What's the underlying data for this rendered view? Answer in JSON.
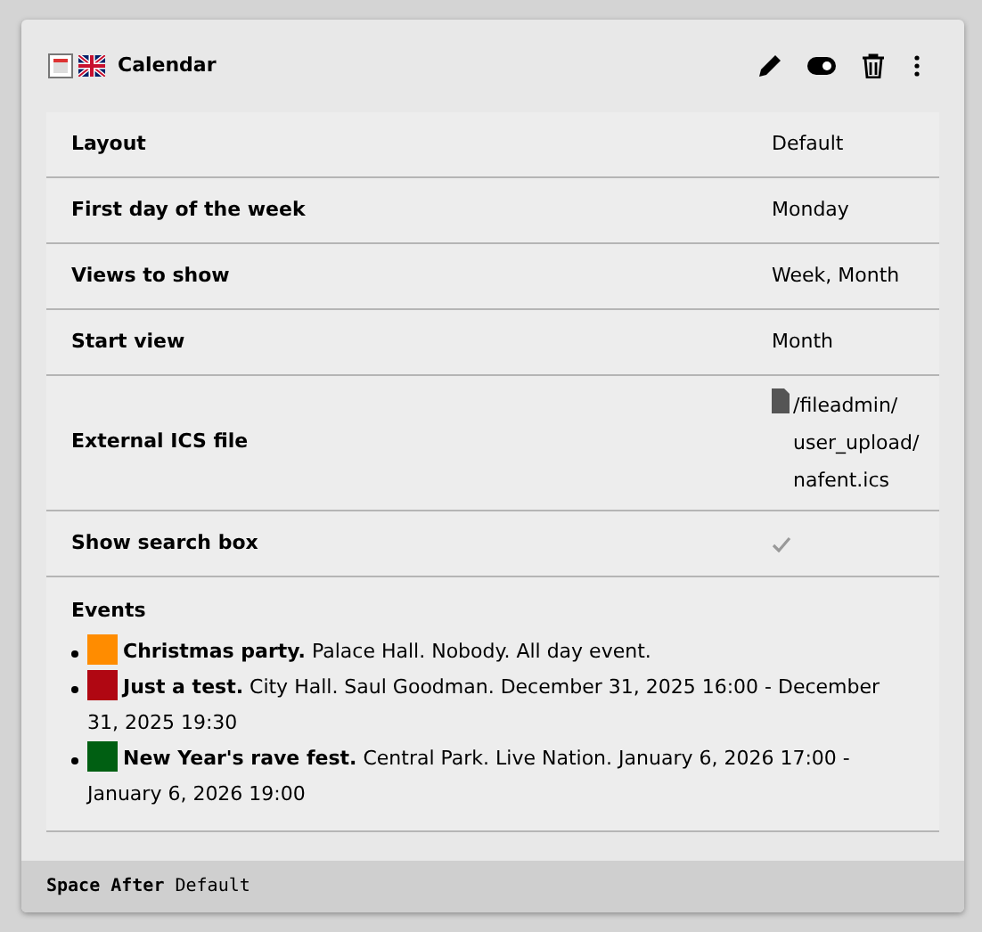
{
  "header": {
    "title": "Calendar"
  },
  "rows": [
    {
      "kind": "text",
      "label": "Layout",
      "value": "Default"
    },
    {
      "kind": "text",
      "label": "First day of the week",
      "value": "Monday"
    },
    {
      "kind": "text",
      "label": "Views to show",
      "value": "Week, Month"
    },
    {
      "kind": "text",
      "label": "Start view",
      "value": "Month"
    },
    {
      "kind": "file",
      "label": "External ICS file",
      "value": "/fileadmin/ user_upload/ nafent.ics"
    },
    {
      "kind": "check",
      "label": "Show search box",
      "checked": true
    }
  ],
  "events": {
    "title": "Events",
    "items": [
      {
        "color": "#ff8c00",
        "text": "**Christmas party.** Palace Hall. Nobody. All day event."
      },
      {
        "color": "#b00712",
        "text": "**Just a test.** City Hall. Saul Goodman. December 31, 2025 16:00 - December 31, 2025 19:30"
      },
      {
        "color": "#005f12",
        "text": "**New Year's rave fest.** Central Park. Live Nation. January 6, 2026 17:00 - January 6, 2026 19:00"
      }
    ]
  },
  "footer": {
    "label": "Space After",
    "value": "Default"
  }
}
